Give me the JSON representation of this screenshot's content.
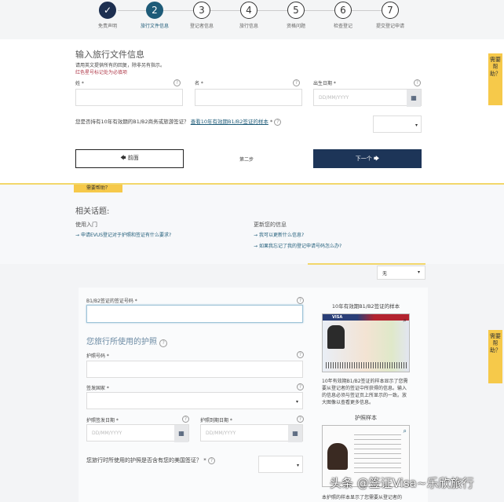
{
  "steps": [
    {
      "num": "✓",
      "label": "免责声明",
      "state": "done"
    },
    {
      "num": "2",
      "label": "旅行文件信息",
      "state": "current"
    },
    {
      "num": "3",
      "label": "登记者信息",
      "state": "todo"
    },
    {
      "num": "4",
      "label": "旅行信息",
      "state": "todo"
    },
    {
      "num": "5",
      "label": "资格问题",
      "state": "todo"
    },
    {
      "num": "6",
      "label": "检查登记",
      "state": "todo"
    },
    {
      "num": "7",
      "label": "提交登记申请",
      "state": "todo"
    }
  ],
  "form": {
    "title": "输入旅行文件信息",
    "instruction": "请用英文提供所有的回复，除非另有指示。",
    "required_note": "红色星号标记处为必填项",
    "surname_label": "姓 *",
    "given_label": "名 *",
    "dob_label": "出生日期 *",
    "date_placeholder": "DD/MM/YYYY",
    "visa_question": "您是否持有10年有效期的B1/B2商务或旅游签证？",
    "visa_sample_link": "查看10年有效期B1/B2签证的样本",
    "required_mark": "*",
    "back_button": "🡄 前面",
    "step_indicator": "第二步",
    "next_button": "下一个 🡆"
  },
  "help": {
    "tab": "需要帮助？",
    "side_tab": "需要帮助？",
    "related_title": "相关话题:",
    "col1_title": "使用入门",
    "col1_links": [
      "申请EVUS登记对于护照和签证有什么要求?"
    ],
    "col2_title": "更新您的信息",
    "col2_links": [
      "我可以更新什么信息?",
      "如果我忘记了我的登记申请号码怎么办?"
    ]
  },
  "form2": {
    "top_select": "无",
    "visa_number_label": "B1/B2签证的签证号码 *",
    "passport_section": "您旅行所使用的护照",
    "passport_number_label": "护照号码 *",
    "country_label": "签发国家 *",
    "issue_date_label": "护照签发日期 *",
    "expiry_date_label": "护照到期日期 *",
    "date_placeholder": "DD/MM/YYYY",
    "passport_visa_question": "您旅行时所使用的护照是否含有您的美国签证？ *",
    "visa_sample_title": "10年有效期B1/B2签证的样本",
    "visa_sample_desc": "10年有效期B1/B2签证的样本显示了您需要从登记者的签证中所获得的信息。输入的信息必须与签证页上所显示的一致。放大图像以查看更多信息。",
    "passport_sample_title": "护照样本",
    "passport_sample_desc": "本护照的样本显示了您需要从登记者的",
    "visa_card_word": "VISA"
  },
  "watermark": "头条 @签证Visa~乐欣旅行"
}
